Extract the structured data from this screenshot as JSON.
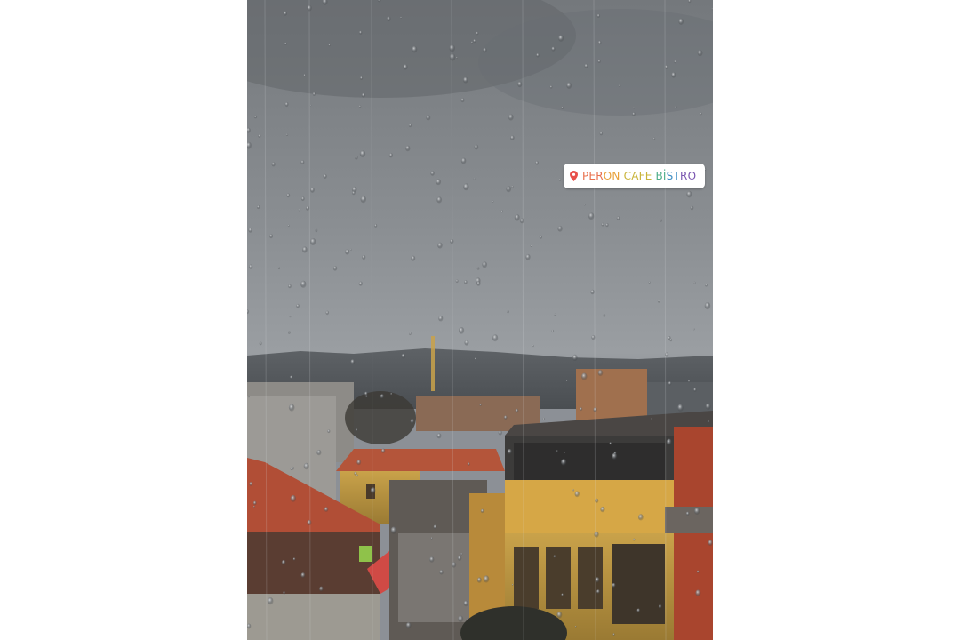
{
  "location_sticker": {
    "icon": "location-pin-icon",
    "text": "PERON CAFE BİSTRO",
    "segments": [
      {
        "text": "PER",
        "color": "#e8704d"
      },
      {
        "text": "ON ",
        "color": "#e8a13a"
      },
      {
        "text": "CAFE ",
        "color": "#c9b43a"
      },
      {
        "text": "Bİ",
        "color": "#4fae8a"
      },
      {
        "text": "ST",
        "color": "#3e8fc4"
      },
      {
        "text": "RO",
        "color": "#7a56b0"
      }
    ],
    "pin_color": "#e8504a"
  },
  "photo": {
    "description_colors": {
      "sky": "#7e8286",
      "roof": "#b4553a",
      "wall": "#c9a24a"
    }
  }
}
